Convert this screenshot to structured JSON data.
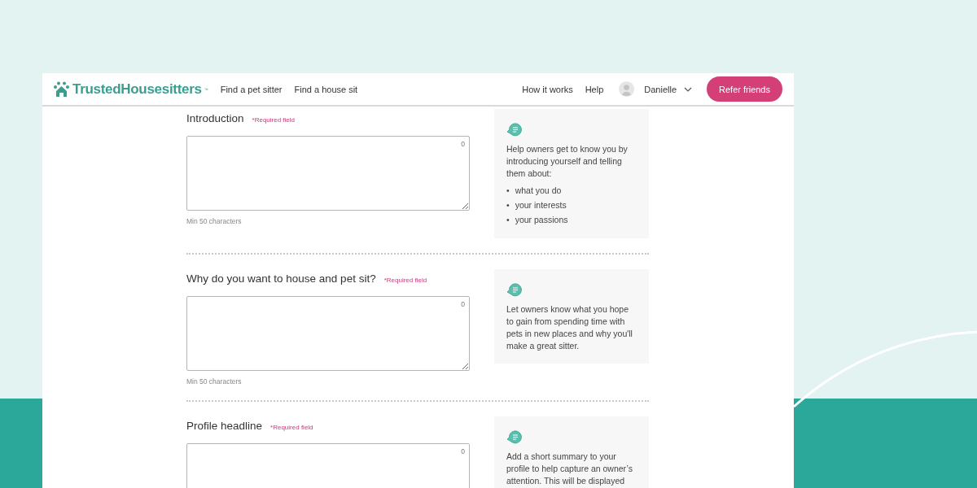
{
  "header": {
    "logo": "TrustedHousesitters",
    "logo_mark": "™",
    "nav_left": [
      "Find a pet sitter",
      "Find a house sit"
    ],
    "nav_right": [
      "How it works",
      "Help"
    ],
    "user": {
      "name": "Danielle"
    },
    "cta": "Refer friends"
  },
  "sections": [
    {
      "title": "Introduction",
      "required": "*Required field",
      "count": "0",
      "hint": "Min 50 characters",
      "tip": {
        "text": "Help owners get to know you by introducing yourself and telling them about:",
        "marker": "•",
        "bullets": [
          "what you do",
          "your interests",
          "your passions"
        ]
      }
    },
    {
      "title": "Why do you want to house and pet sit?",
      "required": "*Required field",
      "count": "0",
      "hint": "Min 50 characters",
      "tip": {
        "text": "Let owners know what you hope to gain from spending time with pets in new places and why you'll make a great sitter."
      }
    },
    {
      "title": "Profile headline",
      "required": "*Required field",
      "count": "0",
      "tip": {
        "text": "Add a short summary to your profile to help capture an owner’s attention. This will be displayed"
      }
    }
  ]
}
